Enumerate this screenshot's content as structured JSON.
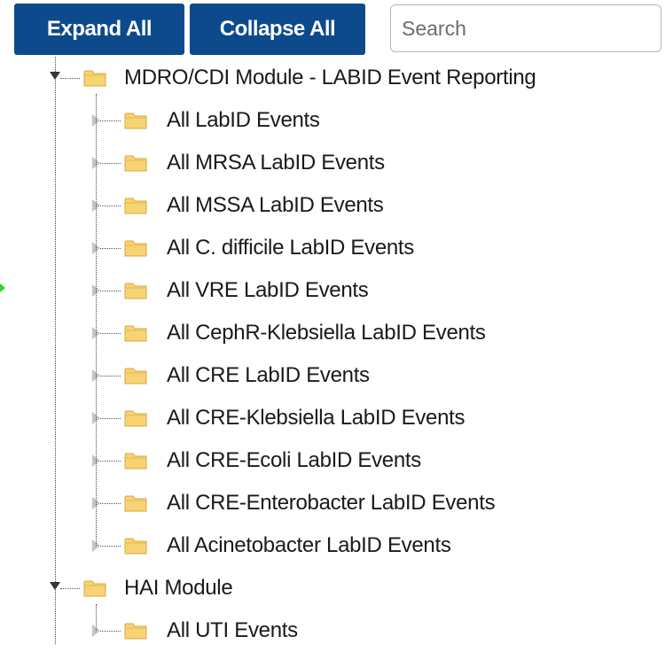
{
  "toolbar": {
    "expand_label": "Expand All",
    "collapse_label": "Collapse All",
    "search_placeholder": "Search"
  },
  "tree": {
    "groups": [
      {
        "label": "MDRO/CDI Module - LABID Event Reporting",
        "expanded": true,
        "icon": "folder-icon",
        "children": [
          "All LabID Events",
          "All MRSA LabID Events",
          "All MSSA LabID Events",
          "All C. difficile LabID Events",
          "All VRE LabID Events",
          "All CephR-Klebsiella LabID Events",
          "All CRE LabID Events",
          "All CRE-Klebsiella LabID Events",
          "All CRE-Ecoli LabID Events",
          "All CRE-Enterobacter LabID Events",
          "All Acinetobacter LabID Events"
        ]
      },
      {
        "label": "HAI Module",
        "expanded": true,
        "icon": "folder-icon",
        "children": [
          "All UTI Events"
        ]
      }
    ]
  },
  "colors": {
    "button_bg": "#0d4a8c",
    "button_text": "#ffffff",
    "folder_fill": "#f7d374",
    "folder_edge": "#d9a93a"
  }
}
